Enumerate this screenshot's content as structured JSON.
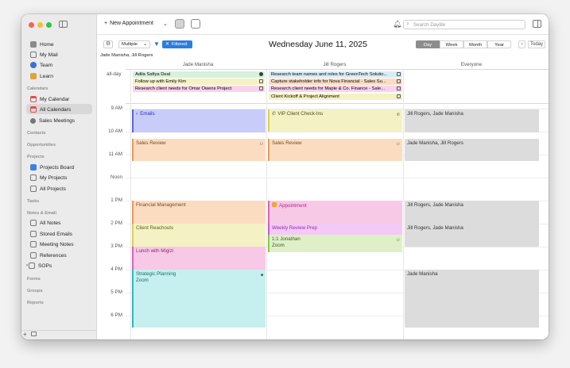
{
  "colors": {
    "accent": "#2a7de1",
    "blue_event": "#c8ccf9",
    "orange_event": "#fbdcc1",
    "yellow_event": "#f4f2c4",
    "pink_event": "#f8c8e7",
    "green_event": "#dff0c8",
    "cyan_event": "#c6efef",
    "gray_event": "#dcdcdc"
  },
  "sidebar": {
    "items": [
      {
        "label": "Home",
        "icon": "home-icon",
        "color": "#888"
      },
      {
        "label": "My Mail",
        "icon": "mail-icon",
        "color": "#888"
      },
      {
        "label": "Team",
        "icon": "team-icon",
        "color": "#3b6fd8"
      },
      {
        "label": "Learn",
        "icon": "book-icon",
        "color": "#e2a23a"
      }
    ],
    "calendars_header": "Calendars",
    "calendars": [
      {
        "label": "My Calendar",
        "icon": "calendar-icon",
        "color": "#d9534f"
      },
      {
        "label": "All Calendars",
        "icon": "calendars-icon",
        "color": "#d9534f"
      },
      {
        "label": "Sales Meetings",
        "icon": "people-icon",
        "color": "#666"
      }
    ],
    "contacts_header": "Contacts",
    "opportunities_header": "Opportunities",
    "projects_header": "Projects",
    "projects": [
      {
        "label": "Projects Board",
        "icon": "folder-icon",
        "color": "#3b82e0"
      },
      {
        "label": "My Projects",
        "icon": "pin-icon",
        "color": "#666"
      },
      {
        "label": "All Projects",
        "icon": "projects-icon",
        "color": "#666"
      }
    ],
    "tasks_header": "Tasks",
    "notes_header": "Notes & Email",
    "notes": [
      {
        "label": "All Notes",
        "icon": "note-icon",
        "color": "#888"
      },
      {
        "label": "Stored Emails",
        "icon": "envelope-icon",
        "color": "#888"
      },
      {
        "label": "Meeting Notes",
        "icon": "note-icon",
        "color": "#888"
      },
      {
        "label": "References",
        "icon": "note-icon",
        "color": "#888"
      },
      {
        "label": "SOPs",
        "icon": "folder-icon",
        "color": "#888"
      }
    ],
    "forms_header": "Forms",
    "groups_header": "Groups",
    "reports_header": "Reports"
  },
  "toolbar": {
    "new_appointment": "New Appointment",
    "search_placeholder": "Search Daylite"
  },
  "controls": {
    "multiple": "Multiple",
    "filtered": "Filtered",
    "date_title": "Wednesday June 11, 2025",
    "views": [
      "Day",
      "Week",
      "Month",
      "Year"
    ],
    "today": "Today",
    "people_line": "Jade Manisha, Jill Rogers"
  },
  "columns": [
    "Jade Manisha",
    "Jill Rogers",
    "Everyone"
  ],
  "allday_label": "all-day",
  "allday_events": {
    "jade": [
      {
        "title": "Adila Safiya Deal",
        "color": "#d6f1dc"
      },
      {
        "title": "Follow up with Emily Kim",
        "color": "#f4f2c4"
      },
      {
        "title": "Research client needs for Omar Owens Project",
        "color": "#f8d3ec"
      }
    ],
    "jill": [
      {
        "title": "Research team names and roles for GreenTech Solutio...",
        "color": "#d6ecf9"
      },
      {
        "title": "Capture stakeholder info for Nova Financial - Sales Su...",
        "color": "#fbdcc1"
      },
      {
        "title": "Research client needs for Maple & Co. Finance - Sale...",
        "color": "#f8d3ec"
      },
      {
        "title": "Client Kickoff & Project Alignment",
        "color": "#f4f2c4"
      }
    ]
  },
  "time_labels": [
    "9 AM",
    "10 AM",
    "11 AM",
    "Noon",
    "1 PM",
    "2 PM",
    "3 PM",
    "4 PM",
    "5 PM",
    "6 PM"
  ],
  "events": {
    "emails": {
      "title": "Emails"
    },
    "vip": {
      "title": "VIP Client Check-Ins"
    },
    "sales_review_jade": {
      "title": "Sales Review"
    },
    "sales_review_jill": {
      "title": "Sales Review"
    },
    "financial_mgmt": {
      "title": "Financial Management"
    },
    "appointment": {
      "title": "Appointment"
    },
    "client_reachouts": {
      "title": "Client Reachouts"
    },
    "weekly_review": {
      "title": "Weekly Review Prep"
    },
    "one_on_one": {
      "title": "1:1 Jonathan",
      "sub": "Zoom"
    },
    "lunch": {
      "title": "Lunch with Migizi"
    },
    "strategic": {
      "title": "Strategic Planning",
      "sub": "Zoom"
    },
    "everyone_1": {
      "title": "Jill Rogers, Jade Manisha"
    },
    "everyone_2": {
      "title": "Jade Manisha, Jill Rogers"
    },
    "everyone_3": {
      "title": "Jill Rogers, Jade Manisha"
    },
    "everyone_4": {
      "title": "Jill Rogers, Jade Manisha"
    },
    "everyone_5": {
      "title": "Jade Manisha"
    }
  }
}
